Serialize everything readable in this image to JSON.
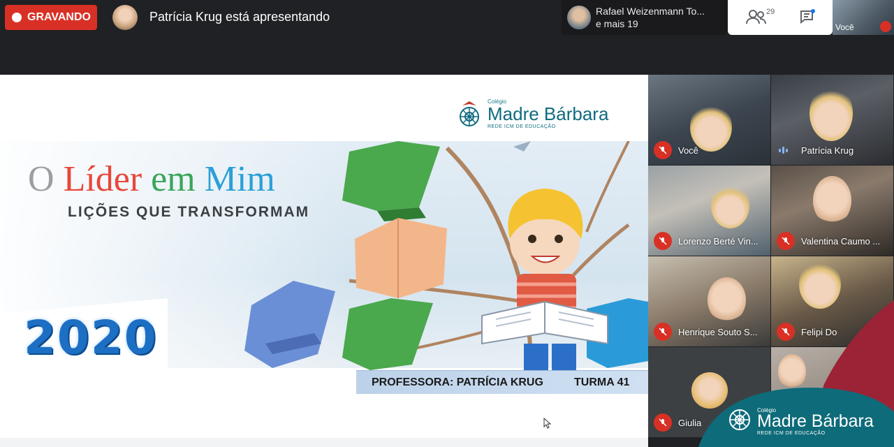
{
  "topbar": {
    "recording_label": "GRAVANDO",
    "presenting_text": "Patrícia Krug está apresentando",
    "people_name": "Rafael Weizenmann To...",
    "people_more": "e mais 19",
    "participant_count": "29",
    "self_label": "Você"
  },
  "slide": {
    "logo_small": "Colégio",
    "logo_main": "Madre Bárbara",
    "logo_sub": "REDE ICM DE EDUCAÇÃO",
    "title_part1": "O",
    "title_part2": "Líder",
    "title_part3": "em",
    "title_part4": "Mim",
    "subtitle": "LIÇÕES QUE TRANSFORMAM",
    "year": "2020",
    "teacher": "PROFESSORA: PATRÍCIA KRUG",
    "class": "TURMA 41",
    "colors": {
      "title_o": "#9e9e9e",
      "title_lider": "#e8473a",
      "title_em": "#3aa55a",
      "title_mim": "#2a9fd8"
    }
  },
  "participants": [
    {
      "name": "Você",
      "muted": true
    },
    {
      "name": "Patrícia Krug",
      "muted": false
    },
    {
      "name": "Lorenzo Berté Vin...",
      "muted": true
    },
    {
      "name": "Valentina Caumo ...",
      "muted": true
    },
    {
      "name": "Henrique Souto S...",
      "muted": true
    },
    {
      "name": "Felipi Do",
      "muted": true
    },
    {
      "name": "Giulia",
      "muted": true
    },
    {
      "name": "",
      "muted": false
    }
  ],
  "brand": {
    "small": "Colégio",
    "main": "Madre Bárbara",
    "sub": "REDE ICM DE EDUCAÇÃO"
  }
}
